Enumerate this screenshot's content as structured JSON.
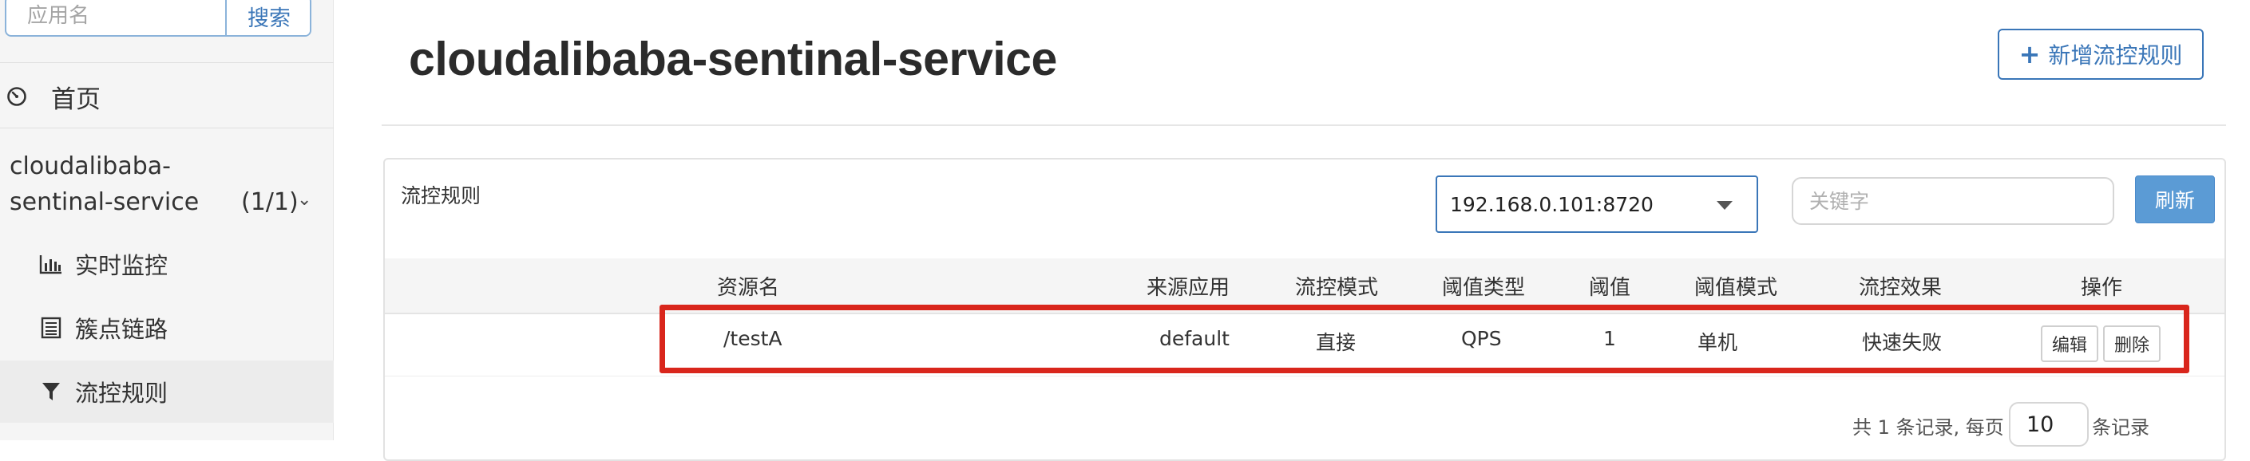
{
  "sidebar": {
    "search_placeholder": "应用名",
    "search_button": "搜索",
    "home_label": "首页",
    "app_name": "cloudalibaba-sentinal-service",
    "app_count": "(1/1)",
    "items": [
      {
        "label": "实时监控",
        "icon": "bar-chart-icon"
      },
      {
        "label": "簇点链路",
        "icon": "list-icon"
      },
      {
        "label": "流控规则",
        "icon": "filter-icon",
        "active": true
      }
    ]
  },
  "header": {
    "title": "cloudalibaba-sentinal-service",
    "add_button": "新增流控规则"
  },
  "panel": {
    "title": "流控规则",
    "machine_select": "192.168.0.101:8720",
    "keyword_placeholder": "关键字",
    "refresh_button": "刷新"
  },
  "table": {
    "columns": [
      "资源名",
      "来源应用",
      "流控模式",
      "阈值类型",
      "阈值",
      "阈值模式",
      "流控效果",
      "操作"
    ],
    "rows": [
      {
        "resource": "/testA",
        "origin": "default",
        "mode": "直接",
        "threshold_type": "QPS",
        "threshold": "1",
        "threshold_mode": "单机",
        "effect": "快速失败",
        "edit": "编辑",
        "delete": "删除"
      }
    ]
  },
  "pager": {
    "total_text": "共 1 条记录, 每页",
    "page_size": "10",
    "suffix": "条记录"
  },
  "colors": {
    "accent": "#3a76b8",
    "highlight": "#d9261c",
    "refresh": "#5b9bd5"
  }
}
